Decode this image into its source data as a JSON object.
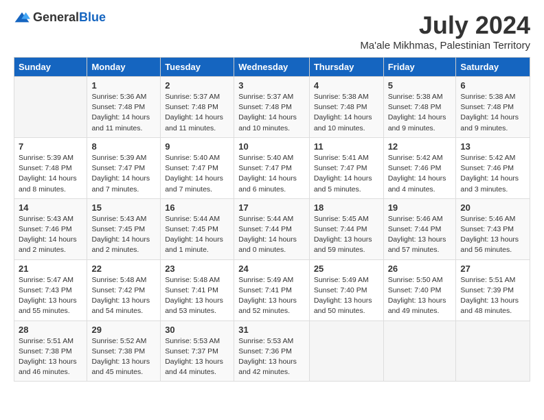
{
  "logo": {
    "general": "General",
    "blue": "Blue"
  },
  "header": {
    "month": "July 2024",
    "location": "Ma'ale Mikhmas, Palestinian Territory"
  },
  "days_of_week": [
    "Sunday",
    "Monday",
    "Tuesday",
    "Wednesday",
    "Thursday",
    "Friday",
    "Saturday"
  ],
  "weeks": [
    [
      {
        "day": "",
        "info": ""
      },
      {
        "day": "1",
        "info": "Sunrise: 5:36 AM\nSunset: 7:48 PM\nDaylight: 14 hours\nand 11 minutes."
      },
      {
        "day": "2",
        "info": "Sunrise: 5:37 AM\nSunset: 7:48 PM\nDaylight: 14 hours\nand 11 minutes."
      },
      {
        "day": "3",
        "info": "Sunrise: 5:37 AM\nSunset: 7:48 PM\nDaylight: 14 hours\nand 10 minutes."
      },
      {
        "day": "4",
        "info": "Sunrise: 5:38 AM\nSunset: 7:48 PM\nDaylight: 14 hours\nand 10 minutes."
      },
      {
        "day": "5",
        "info": "Sunrise: 5:38 AM\nSunset: 7:48 PM\nDaylight: 14 hours\nand 9 minutes."
      },
      {
        "day": "6",
        "info": "Sunrise: 5:38 AM\nSunset: 7:48 PM\nDaylight: 14 hours\nand 9 minutes."
      }
    ],
    [
      {
        "day": "7",
        "info": "Sunrise: 5:39 AM\nSunset: 7:48 PM\nDaylight: 14 hours\nand 8 minutes."
      },
      {
        "day": "8",
        "info": "Sunrise: 5:39 AM\nSunset: 7:47 PM\nDaylight: 14 hours\nand 7 minutes."
      },
      {
        "day": "9",
        "info": "Sunrise: 5:40 AM\nSunset: 7:47 PM\nDaylight: 14 hours\nand 7 minutes."
      },
      {
        "day": "10",
        "info": "Sunrise: 5:40 AM\nSunset: 7:47 PM\nDaylight: 14 hours\nand 6 minutes."
      },
      {
        "day": "11",
        "info": "Sunrise: 5:41 AM\nSunset: 7:47 PM\nDaylight: 14 hours\nand 5 minutes."
      },
      {
        "day": "12",
        "info": "Sunrise: 5:42 AM\nSunset: 7:46 PM\nDaylight: 14 hours\nand 4 minutes."
      },
      {
        "day": "13",
        "info": "Sunrise: 5:42 AM\nSunset: 7:46 PM\nDaylight: 14 hours\nand 3 minutes."
      }
    ],
    [
      {
        "day": "14",
        "info": "Sunrise: 5:43 AM\nSunset: 7:46 PM\nDaylight: 14 hours\nand 2 minutes."
      },
      {
        "day": "15",
        "info": "Sunrise: 5:43 AM\nSunset: 7:45 PM\nDaylight: 14 hours\nand 2 minutes."
      },
      {
        "day": "16",
        "info": "Sunrise: 5:44 AM\nSunset: 7:45 PM\nDaylight: 14 hours\nand 1 minute."
      },
      {
        "day": "17",
        "info": "Sunrise: 5:44 AM\nSunset: 7:44 PM\nDaylight: 14 hours\nand 0 minutes."
      },
      {
        "day": "18",
        "info": "Sunrise: 5:45 AM\nSunset: 7:44 PM\nDaylight: 13 hours\nand 59 minutes."
      },
      {
        "day": "19",
        "info": "Sunrise: 5:46 AM\nSunset: 7:44 PM\nDaylight: 13 hours\nand 57 minutes."
      },
      {
        "day": "20",
        "info": "Sunrise: 5:46 AM\nSunset: 7:43 PM\nDaylight: 13 hours\nand 56 minutes."
      }
    ],
    [
      {
        "day": "21",
        "info": "Sunrise: 5:47 AM\nSunset: 7:43 PM\nDaylight: 13 hours\nand 55 minutes."
      },
      {
        "day": "22",
        "info": "Sunrise: 5:48 AM\nSunset: 7:42 PM\nDaylight: 13 hours\nand 54 minutes."
      },
      {
        "day": "23",
        "info": "Sunrise: 5:48 AM\nSunset: 7:41 PM\nDaylight: 13 hours\nand 53 minutes."
      },
      {
        "day": "24",
        "info": "Sunrise: 5:49 AM\nSunset: 7:41 PM\nDaylight: 13 hours\nand 52 minutes."
      },
      {
        "day": "25",
        "info": "Sunrise: 5:49 AM\nSunset: 7:40 PM\nDaylight: 13 hours\nand 50 minutes."
      },
      {
        "day": "26",
        "info": "Sunrise: 5:50 AM\nSunset: 7:40 PM\nDaylight: 13 hours\nand 49 minutes."
      },
      {
        "day": "27",
        "info": "Sunrise: 5:51 AM\nSunset: 7:39 PM\nDaylight: 13 hours\nand 48 minutes."
      }
    ],
    [
      {
        "day": "28",
        "info": "Sunrise: 5:51 AM\nSunset: 7:38 PM\nDaylight: 13 hours\nand 46 minutes."
      },
      {
        "day": "29",
        "info": "Sunrise: 5:52 AM\nSunset: 7:38 PM\nDaylight: 13 hours\nand 45 minutes."
      },
      {
        "day": "30",
        "info": "Sunrise: 5:53 AM\nSunset: 7:37 PM\nDaylight: 13 hours\nand 44 minutes."
      },
      {
        "day": "31",
        "info": "Sunrise: 5:53 AM\nSunset: 7:36 PM\nDaylight: 13 hours\nand 42 minutes."
      },
      {
        "day": "",
        "info": ""
      },
      {
        "day": "",
        "info": ""
      },
      {
        "day": "",
        "info": ""
      }
    ]
  ]
}
